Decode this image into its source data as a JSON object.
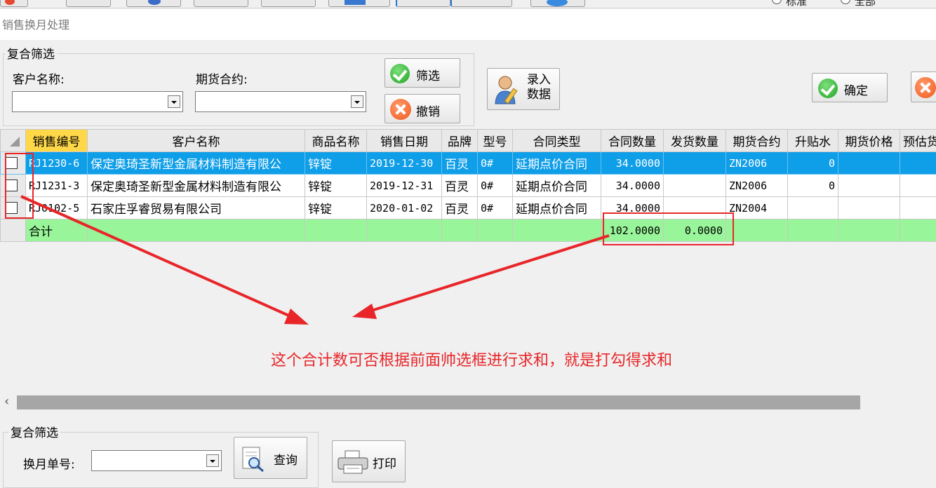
{
  "window": {
    "title": "销售换月处理"
  },
  "top_toolbar": {
    "radio_standard": "标准",
    "radio_all": "全部"
  },
  "filter": {
    "legend": "复合筛选",
    "customer_label": "客户名称:",
    "customer_value": "",
    "futures_label": "期货合约:",
    "futures_value": "",
    "filter_button": "筛选",
    "cancel_button": "撤销",
    "entry_button_line1": "录入",
    "entry_button_line2": "数据",
    "confirm_button": "确定"
  },
  "grid": {
    "columns": [
      "销售编号",
      "客户名称",
      "商品名称",
      "销售日期",
      "品牌",
      "型号",
      "合同类型",
      "合同数量",
      "发货数量",
      "期货合约",
      "升贴水",
      "期货价格",
      "预估货"
    ],
    "rows": [
      {
        "checked": false,
        "selected": true,
        "cells": [
          "RJ1230-6",
          "保定奥琦圣新型金属材料制造有限公",
          "锌锭",
          "2019-12-30",
          "百灵",
          "0#",
          "延期点价合同",
          "34.0000",
          "",
          "ZN2006",
          "0",
          "",
          ""
        ]
      },
      {
        "checked": false,
        "selected": false,
        "cells": [
          "RJ1231-3",
          "保定奥琦圣新型金属材料制造有限公",
          "锌锭",
          "2019-12-31",
          "百灵",
          "0#",
          "延期点价合同",
          "34.0000",
          "",
          "ZN2006",
          "0",
          "",
          ""
        ]
      },
      {
        "checked": false,
        "selected": false,
        "cells": [
          "RJ0102-5",
          "石家庄孚睿贸易有限公司",
          "锌锭",
          "2020-01-02",
          "百灵",
          "0#",
          "延期点价合同",
          "34.0000",
          "",
          "ZN2004",
          "",
          "",
          ""
        ]
      }
    ],
    "total": {
      "label": "合计",
      "contract_qty": "102.0000",
      "shipped_qty": "0.0000"
    }
  },
  "annotation": {
    "text": "这个合计数可否根据前面帅选框进行求和，就是打勾得求和",
    "color": "#e8262a"
  },
  "bottom": {
    "legend": "复合筛选",
    "month_no_label": "换月单号:",
    "month_no_value": "",
    "query_button": "查询",
    "print_button": "打印"
  },
  "colors": {
    "selected_row": "#0f9ee8",
    "total_row": "#99f599",
    "sort_header": "#ffd84a"
  }
}
